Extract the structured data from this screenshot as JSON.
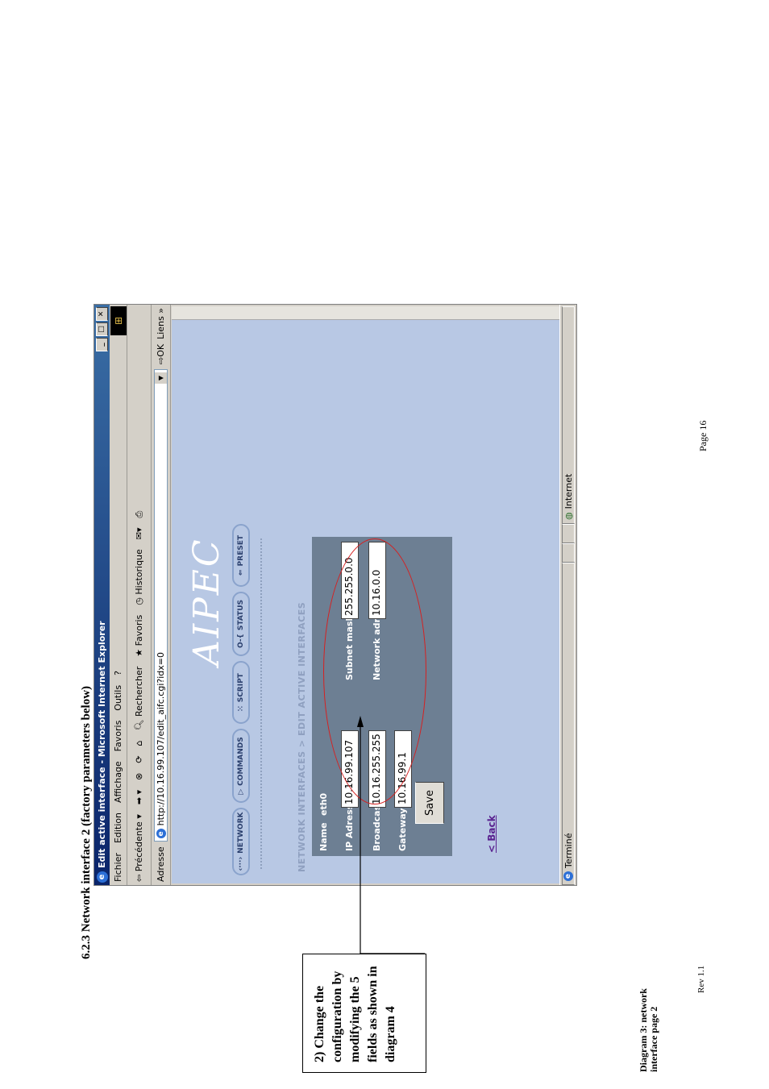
{
  "doc": {
    "heading": "6.2.3 Network interface 2     (factory parameters below)",
    "page": "Page 16",
    "caption": "Diagram 3: network interface page 2",
    "rev": "Rev 1.1",
    "callout": "2) Change the configuration by modifying the 5 fields as shown in diagram 4"
  },
  "browser": {
    "title": "Edit active interface - Microsoft Internet Explorer",
    "menu": [
      "Fichier",
      "Edition",
      "Affichage",
      "Favoris",
      "Outils",
      "?"
    ],
    "toolbar": {
      "back": "Précédente",
      "search": "Rechercher",
      "favorites": "Favoris",
      "history": "Historique"
    },
    "address_label": "Adresse",
    "address": "http://10.16.99.107/edit_aifc.cgi?idx=0",
    "go": "OK",
    "links": "Liens",
    "status_left": "Terminé",
    "status_zone": "Internet"
  },
  "page": {
    "logo": "AIPEC",
    "nav": [
      "NETWORK",
      "COMMANDS",
      "SCRIPT",
      "STATUS",
      "PRESET"
    ],
    "breadcrumb": "NETWORK INTERFACES > EDIT ACTIVE INTERFACES",
    "form": {
      "name_label": "Name",
      "name_value": "eth0",
      "ip_label": "IP Adress",
      "ip_value": "10.16.99.107",
      "subnet_label": "Subnet mask",
      "subnet_value": "255.255.0.0",
      "broadcast_label": "Broadcast",
      "broadcast_value": "10.16.255.255",
      "network_label": "Network adress",
      "network_value": "10.16.0.0",
      "gateway_label": "Gateway",
      "gateway_value": "10.16.99.1",
      "save": "Save"
    },
    "back": "< Back"
  }
}
